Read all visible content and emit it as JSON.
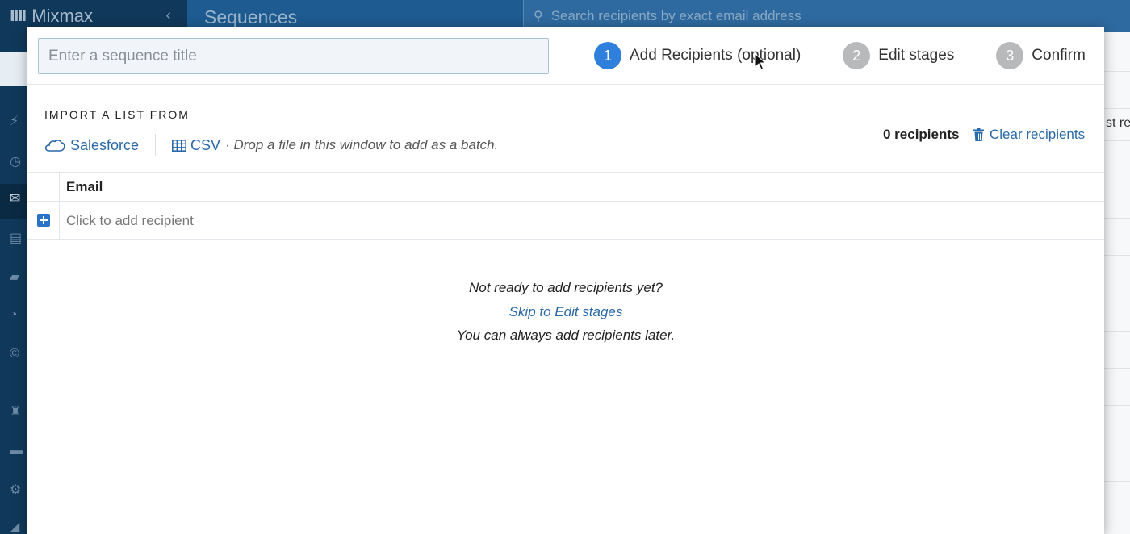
{
  "app": {
    "brand": "Mixmax",
    "page_title": "Sequences",
    "search_placeholder": "Search recipients by exact email address",
    "peek_text": "st rec"
  },
  "modal": {
    "title_placeholder": "Enter a sequence title",
    "steps": [
      {
        "num": "1",
        "label": "Add Recipients (optional)",
        "active": true
      },
      {
        "num": "2",
        "label": "Edit stages",
        "active": false
      },
      {
        "num": "3",
        "label": "Confirm",
        "active": false
      }
    ],
    "import": {
      "title": "IMPORT A LIST FROM",
      "salesforce": "Salesforce",
      "csv": "CSV",
      "drop_hint": "· Drop a file in this window to add as a batch."
    },
    "recipients_count": "0 recipients",
    "clear_label": "Clear recipients",
    "table": {
      "email_header": "Email",
      "add_recipient": "Click to add recipient"
    },
    "empty": {
      "line1": "Not ready to add recipients yet?",
      "skip_link": "Skip to Edit stages",
      "line3": "You can always add recipients later."
    }
  },
  "colors": {
    "accent": "#2f80dd",
    "link": "#2a69a8",
    "sidebar": "#10385a",
    "topbar": "#1e5b91"
  }
}
